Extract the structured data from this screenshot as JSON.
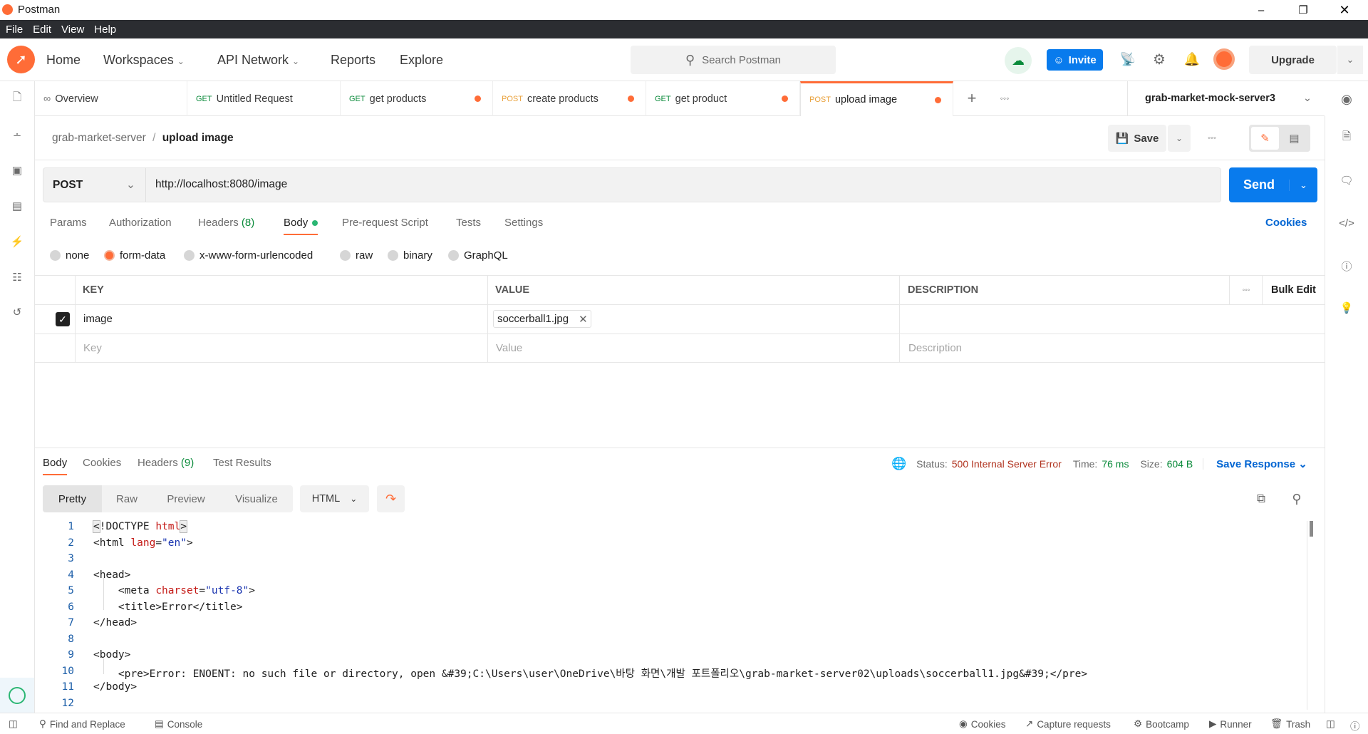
{
  "window": {
    "title": "Postman"
  },
  "menu": [
    "File",
    "Edit",
    "View",
    "Help"
  ],
  "header": {
    "nav": {
      "home": "Home",
      "workspaces": "Workspaces",
      "api_network": "API Network",
      "reports": "Reports",
      "explore": "Explore"
    },
    "search_placeholder": "Search Postman",
    "invite": "Invite",
    "upgrade": "Upgrade"
  },
  "tabs": [
    {
      "label": "Overview"
    },
    {
      "method": "GET",
      "label": "Untitled Request"
    },
    {
      "method": "GET",
      "label": "get products",
      "dirty": true
    },
    {
      "method": "POST",
      "label": "create products",
      "dirty": true
    },
    {
      "method": "GET",
      "label": "get product",
      "dirty": true
    },
    {
      "method": "POST",
      "label": "upload image",
      "dirty": true,
      "active": true
    }
  ],
  "environment": "grab-market-mock-server3",
  "breadcrumb": {
    "collection": "grab-market-server",
    "sep": "/",
    "request": "upload image"
  },
  "toolbar": {
    "save": "Save"
  },
  "request": {
    "method": "POST",
    "url": "http://localhost:8080/image",
    "send": "Send",
    "tabs": {
      "params": "Params",
      "authorization": "Authorization",
      "headers": "Headers",
      "headers_count": "(8)",
      "body": "Body",
      "prerequest": "Pre-request Script",
      "tests": "Tests",
      "settings": "Settings"
    },
    "cookies": "Cookies",
    "body_modes": [
      "none",
      "form-data",
      "x-www-form-urlencoded",
      "raw",
      "binary",
      "GraphQL"
    ],
    "body_mode_selected": "form-data",
    "table": {
      "headers": {
        "key": "KEY",
        "value": "VALUE",
        "description": "DESCRIPTION",
        "bulk_edit": "Bulk Edit"
      },
      "rows": [
        {
          "checked": true,
          "key": "image",
          "value": "soccerball1.jpg",
          "description": ""
        }
      ],
      "placeholders": {
        "key": "Key",
        "value": "Value",
        "description": "Description"
      }
    }
  },
  "response": {
    "tabs": {
      "body": "Body",
      "cookies": "Cookies",
      "headers": "Headers",
      "headers_count": "(9)",
      "tests": "Test Results"
    },
    "status_label": "Status:",
    "status": "500 Internal Server Error",
    "time_label": "Time:",
    "time": "76 ms",
    "size_label": "Size:",
    "size": "604 B",
    "save_response": "Save Response",
    "views": {
      "pretty": "Pretty",
      "raw": "Raw",
      "preview": "Preview",
      "visualize": "Visualize"
    },
    "format": "HTML",
    "code": [
      [
        [
          "br",
          "<"
        ],
        [
          "tag",
          "!DOCTYPE "
        ],
        [
          "attr",
          "html"
        ],
        [
          "br",
          ">"
        ]
      ],
      [
        [
          "tag",
          "<html "
        ],
        [
          "attr",
          "lang"
        ],
        [
          "tag",
          "="
        ],
        [
          "str",
          "\"en\""
        ],
        [
          "tag",
          ">"
        ]
      ],
      [],
      [
        [
          "tag",
          "<head>"
        ]
      ],
      [
        [
          "tag",
          "    <meta "
        ],
        [
          "attr",
          "charset"
        ],
        [
          "tag",
          "="
        ],
        [
          "str",
          "\"utf-8\""
        ],
        [
          "tag",
          ">"
        ]
      ],
      [
        [
          "tag",
          "    <title>Error</title>"
        ]
      ],
      [
        [
          "tag",
          "</head>"
        ]
      ],
      [],
      [
        [
          "tag",
          "<body>"
        ]
      ],
      [
        [
          "tag",
          "    <pre>Error: ENOENT: no such file or directory, open &#39;C:\\Users\\user\\OneDrive\\바탕 화면\\개발 포트폴리오\\grab-market-server02\\uploads\\soccerball1.jpg&#39;</pre>"
        ]
      ],
      [
        [
          "tag",
          "</body>"
        ]
      ],
      []
    ]
  },
  "statusbar": {
    "find_replace": "Find and Replace",
    "console": "Console",
    "cookies": "Cookies",
    "capture": "Capture requests",
    "bootcamp": "Bootcamp",
    "runner": "Runner",
    "trash": "Trash"
  },
  "colors": {
    "brand": "#ff6c37",
    "primary": "#0265d2",
    "menubar": "#2b2d31"
  }
}
